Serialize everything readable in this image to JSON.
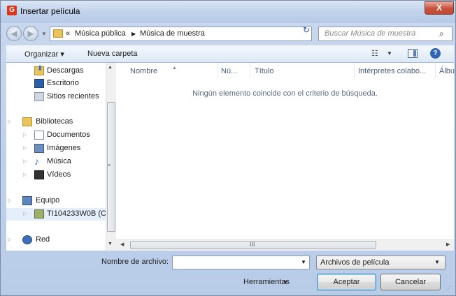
{
  "window": {
    "title": "Insertar película",
    "close_label": "X",
    "app_icon_letter": "G"
  },
  "navbar": {
    "breadcrumb_prefix": "«",
    "breadcrumb": [
      "Música pública",
      "Música de muestra"
    ],
    "search_placeholder": "Buscar Música de muestra"
  },
  "toolbar": {
    "organize": "Organizar ▾",
    "new_folder": "Nueva carpeta",
    "help": "?"
  },
  "sidebar": {
    "items": [
      {
        "label": "Descargas",
        "icon": "downloads-icon"
      },
      {
        "label": "Escritorio",
        "icon": "desktop-icon"
      },
      {
        "label": "Sitios recientes",
        "icon": "recent-places-icon"
      },
      {
        "label": "Bibliotecas",
        "icon": "libraries-icon"
      },
      {
        "label": "Documentos",
        "icon": "documents-icon"
      },
      {
        "label": "Imágenes",
        "icon": "images-icon"
      },
      {
        "label": "Música",
        "icon": "music-icon"
      },
      {
        "label": "Vídeos",
        "icon": "videos-icon"
      },
      {
        "label": "Equipo",
        "icon": "computer-icon"
      },
      {
        "label": "TI104233W0B (C:",
        "icon": "drive-icon"
      },
      {
        "label": "Red",
        "icon": "network-icon"
      }
    ]
  },
  "list": {
    "columns": [
      "Nombre",
      "Nú...",
      "Título",
      "Intérpretes colabo...",
      "Álbu"
    ],
    "empty_message": "Ningún elemento coincide con el criterio de búsqueda."
  },
  "footer": {
    "filename_label": "Nombre de archivo:",
    "filename_value": "",
    "filetype": "Archivos de película",
    "tools": "Herramientas",
    "accept": "Aceptar",
    "cancel": "Cancelar"
  },
  "colors": {
    "accent": "#2f63b5",
    "close": "#c7503a",
    "titlebar": "#c3d4ec"
  }
}
